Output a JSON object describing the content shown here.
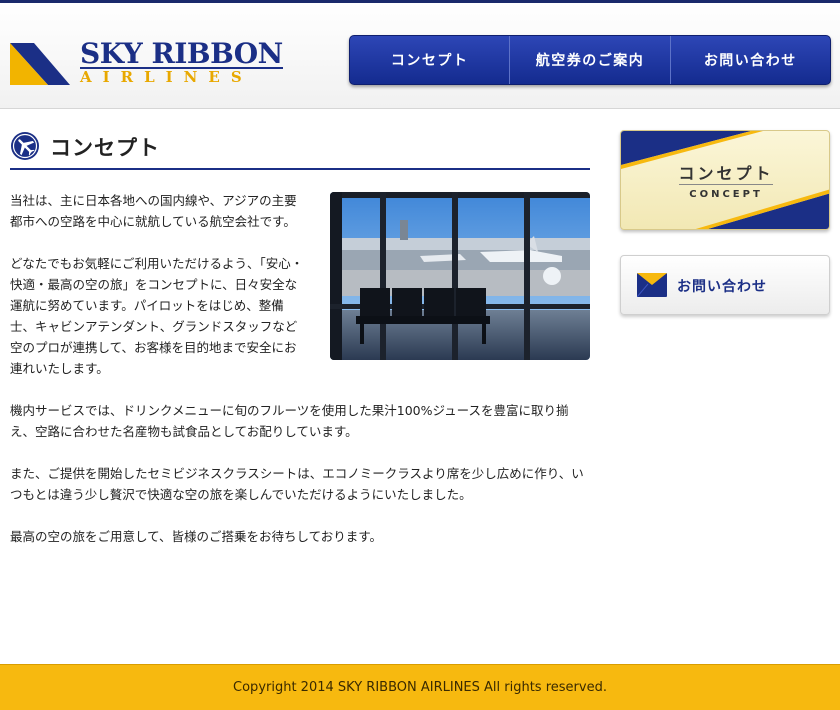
{
  "brand": {
    "name": "SKY RIBBON",
    "sub": "AIRLINES"
  },
  "nav": {
    "items": [
      {
        "label": "コンセプト"
      },
      {
        "label": "航空券のご案内"
      },
      {
        "label": "お問い合わせ"
      }
    ]
  },
  "main": {
    "heading": "コンセプト",
    "paragraphs": [
      "当社は、主に日本各地への国内線や、アジアの主要都市への空路を中心に就航している航空会社です。",
      "どなたでもお気軽にご利用いただけるよう、「安心・快適・最高の空の旅」をコンセプトに、日々安全な運航に努めています。パイロットをはじめ、整備士、キャビンアテンダント、グランドスタッフなど空のプロが連携して、お客様を目的地まで安全にお連れいたします。",
      "機内サービスでは、ドリンクメニューに旬のフルーツを使用した果汁100%ジュースを豊富に取り揃え、空路に合わせた名産物も試食品としてお配りしています。",
      "また、ご提供を開始したセミビジネスクラスシートは、エコノミークラスより席を少し広めに作り、いつもとは違う少し贅沢で快適な空の旅を楽しんでいただけるようにいたしました。",
      "最高の空の旅をご用意して、皆様のご搭乗をお待ちしております。"
    ]
  },
  "sidebar": {
    "concept_ja": "コンセプト",
    "concept_en": "CONCEPT",
    "contact": "お問い合わせ"
  },
  "footer": {
    "copyright": "Copyright 2014 SKY RIBBON AIRLINES All rights reserved."
  },
  "colors": {
    "brand_blue": "#1b2f86",
    "brand_gold": "#f7b90f"
  },
  "icons": {
    "heading": "airplane-circle-icon",
    "contact": "mail-icon"
  }
}
